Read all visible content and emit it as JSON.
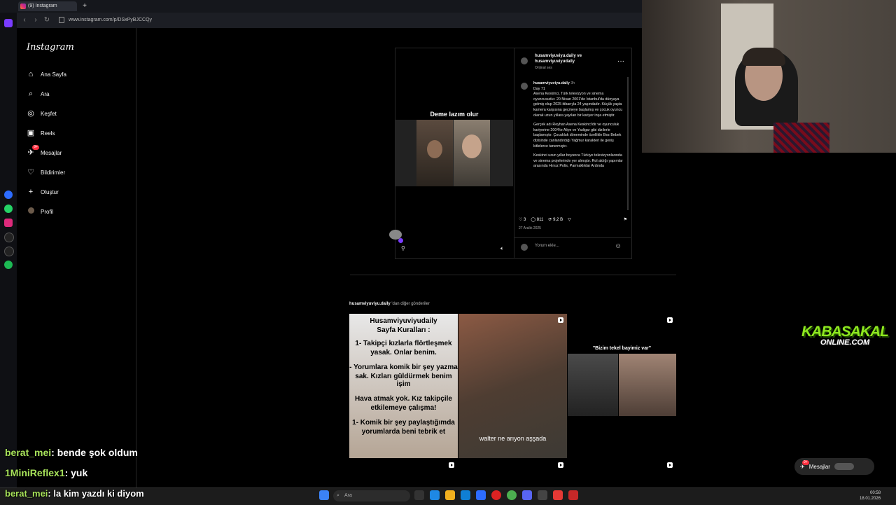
{
  "browser": {
    "tab_title": "(9) Instagram",
    "new_tab": "+",
    "url": "www.instagram.com/p/DSxPyBJCCQy"
  },
  "sidebar": {
    "logo": "Instagram",
    "items": [
      {
        "label": "Ana Sayfa",
        "icon": "home-icon"
      },
      {
        "label": "Ara",
        "icon": "search-icon"
      },
      {
        "label": "Keşfet",
        "icon": "compass-icon"
      },
      {
        "label": "Reels",
        "icon": "reels-icon"
      },
      {
        "label": "Mesajlar",
        "icon": "messenger-icon",
        "badge": "9+"
      },
      {
        "label": "Bildirimler",
        "icon": "heart-icon"
      },
      {
        "label": "Oluştur",
        "icon": "plus-icon"
      },
      {
        "label": "Profil",
        "icon": "avatar"
      }
    ]
  },
  "post": {
    "video_caption": "Deme lazım olur",
    "authors": "husamviyuviyu.daily ve husamviyuviyudaily",
    "audio": "Orijinal ses",
    "caption_user": "husamviyuviyu.daily",
    "caption_time": "3h",
    "caption_paragraphs": [
      "Day 71\nAsena Keskinci, Türk televizyon ve sinema oyuncusudur. 20 Nisan 2001'de İstanbul'da dünyaya gelmiş olup 2025 itibarıyla 24 yaşındadır. Küçük yaşta kamera karşısına geçmeye başlamış ve çocuk oyuncu olarak uzun yıllara yayılan bir kariyer inşa etmiştir.",
      "Gerçek adı Reyhan Asena Keskinci'dir ve oyunculuk kariyerine 2004'te Aliye ve Yadigar gibi dizilerle başlamıştır. Çocukluk döneminde özellikle Bez Bebek dizisinde canlandırdığı Yağmur karakteri ile geniş kitlelerce tanınmıştır.",
      "Keskinci uzun yıllar boyunca Türkiye televizyonlarında ve sinema projelerinde yer almıştır. Rol aldığı yapımlar arasında Hırsız Polis, Parmaklıklar Ardında"
    ],
    "likes": "3",
    "comments": "811",
    "reposts": "9,2 B",
    "date": "27 Aralık 2025",
    "comment_placeholder": "Yorum ekle..."
  },
  "more_posts": {
    "heading_user": "husamviyuviyu.daily",
    "heading_suffix": " 'dan diğer gönderiler",
    "tiles": [
      {
        "lines": [
          "Husamviyuviyudaily",
          "Sayfa Kuralları :",
          "1- Takipçi kızlarla flörtleşmek",
          "yasak. Onlar benim.",
          "- Yorumlara komik bir şey yazma",
          "sak. Kızları güldürmek benim işim",
          "Hava atmak yok. Kız takipçile",
          "etkilemeye çalışma!",
          "1- Komik bir şey paylaştığımda",
          "yorumlarda beni tebrik et"
        ]
      },
      {
        "caption": "walter ne arıyon aşşada"
      },
      {
        "caption": "\"Bizim tekel bayimiz var\""
      }
    ]
  },
  "overlay": {
    "brand_line1": "KABASAKAL",
    "brand_line2": "ONLINE.COM",
    "messages_pill": "Mesajlar",
    "messages_badge": "9+",
    "chat": [
      {
        "user": "berat_mei",
        "text": ": bende şok oldum"
      },
      {
        "user": "1MiniReflex1",
        "text": ": yuk"
      },
      {
        "user": "berat_mei",
        "text": ": la kim yazdı ki diyom"
      }
    ]
  },
  "taskbar": {
    "search_placeholder": "Ara",
    "time": "00:58",
    "date": "18.01.2026"
  },
  "colors": {
    "accent": "#ff3040",
    "bg": "#000000",
    "brand_green": "#8ee81f"
  }
}
